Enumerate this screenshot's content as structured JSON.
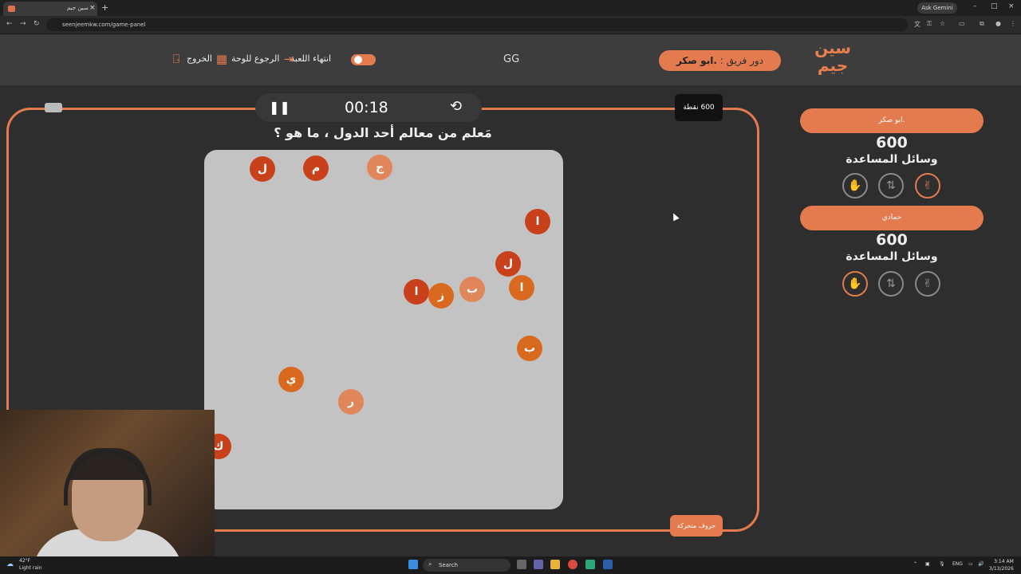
{
  "browser": {
    "tab_title": "سين جيم",
    "url": "seenjeemkw.com/game-panel",
    "ask_gemini": "Ask Gemini"
  },
  "header": {
    "logo_text_line1": "سين",
    "logo_text_line2": "جيم",
    "turn_prefix": "دور فريق :",
    "turn_team": ".ابو صكر",
    "gg": "GG",
    "end_game": "انتهاء اللعبة",
    "back_to_board": "الرجوع للوحة",
    "exit": "الخروج"
  },
  "game": {
    "timer": "00:18",
    "points_badge": "600 نقطة",
    "question": "مَعلم من معالم أحد الدول ، ما هو ؟",
    "moving_letters_button": "حروف متحركة",
    "letters": [
      "ل",
      "م",
      "ج",
      "ا",
      "ل",
      "ا",
      "ز",
      "ب",
      "ا",
      "ب",
      "ي",
      "ر",
      "ك"
    ]
  },
  "teams": [
    {
      "name": ".ابو صكر",
      "score": "600",
      "aids_label": "وسائل المساعدة"
    },
    {
      "name": "حمادي",
      "score": "600",
      "aids_label": "وسائل المساعدة"
    }
  ],
  "taskbar": {
    "weather_temp": "42°F",
    "weather_desc": "Light rain",
    "search": "Search",
    "lang": "ENG",
    "time": "3:14 AM",
    "date": "3/13/2026"
  },
  "colors": {
    "accent": "#e47b4e",
    "board": "#c3c3c3",
    "background": "#2e2e2e"
  }
}
